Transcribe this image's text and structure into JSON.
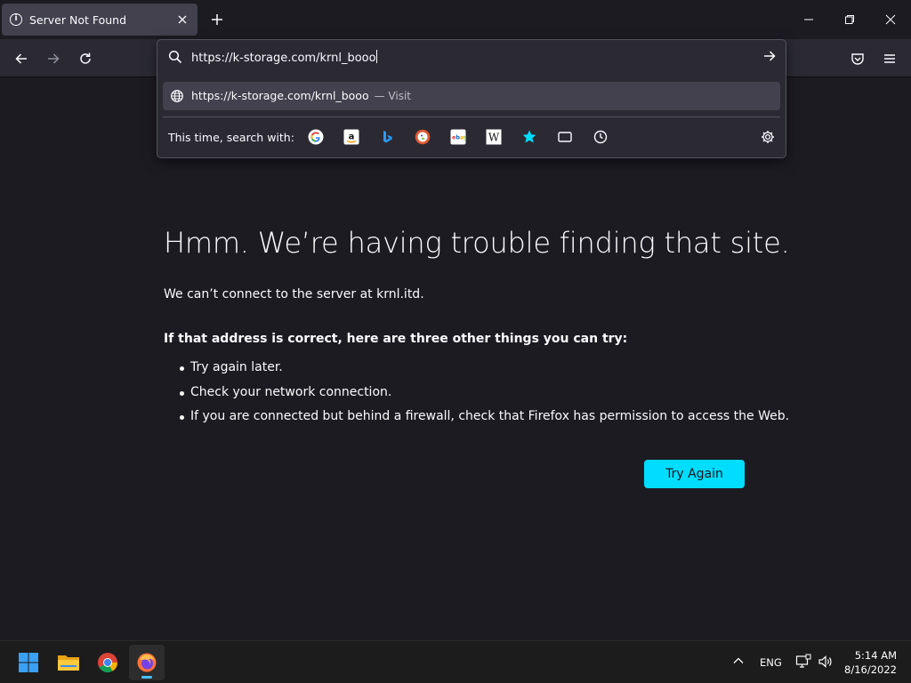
{
  "tab": {
    "title": "Server Not Found"
  },
  "urlbar": {
    "value": "https://k-storage.com/krnl_booo",
    "suggestion_url": "https://k-storage.com/krnl_booo",
    "suggestion_action": "— Visit",
    "search_with_label": "This time, search with:",
    "engines": [
      "google-icon",
      "amazon-icon",
      "bing-icon",
      "duckduckgo-icon",
      "ebay-icon",
      "wikipedia-icon",
      "bookmarks-icon",
      "tabs-icon",
      "history-icon"
    ]
  },
  "error": {
    "title": "Hmm. We’re having trouble finding that site.",
    "description": "We can’t connect to the server at krnl.itd.",
    "suggestions_heading": "If that address is correct, here are three other things you can try:",
    "suggestions": [
      "Try again later.",
      "Check your network connection.",
      "If you are connected but behind a firewall, check that Firefox has permission to access the Web."
    ],
    "button": "Try Again"
  },
  "taskbar": {
    "language": "ENG",
    "time": "5:14 AM",
    "date": "8/16/2022"
  },
  "colors": {
    "page_bg": "#1c1b22",
    "toolbar_bg": "#2b2a33",
    "accent": "#00ddff",
    "taskbar_bg": "#1c1c1c"
  }
}
